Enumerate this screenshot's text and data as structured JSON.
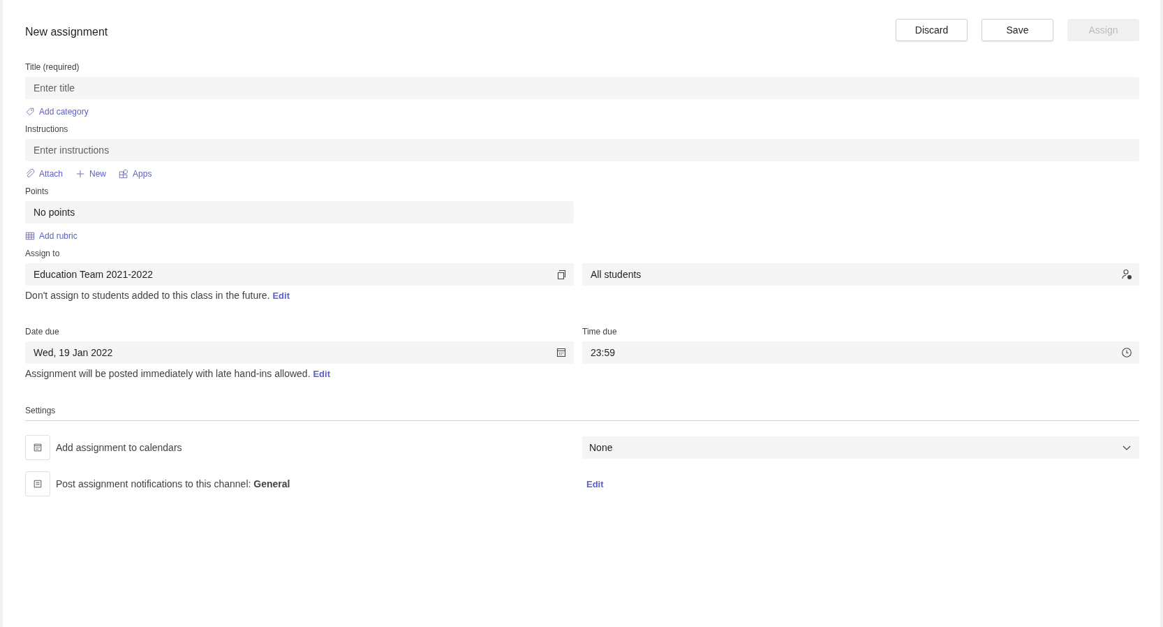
{
  "header": {
    "title": "New assignment"
  },
  "actions": [
    {
      "label": "Discard",
      "disabled": false
    },
    {
      "label": "Save",
      "disabled": false
    },
    {
      "label": "Assign",
      "disabled": true
    }
  ],
  "title_field": {
    "label": "Title (required)",
    "placeholder": "Enter title"
  },
  "add_category": "Add category",
  "instructions_field": {
    "label": "Instructions",
    "placeholder": "Enter instructions"
  },
  "attach_tools": [
    {
      "kind": "attach",
      "label": "Attach"
    },
    {
      "kind": "new",
      "label": "New"
    },
    {
      "kind": "apps",
      "label": "Apps"
    }
  ],
  "points_field": {
    "label": "Points",
    "value": "No points"
  },
  "add_rubric": "Add rubric",
  "assign_to": {
    "label": "Assign to",
    "class_value": "Education Team 2021-2022",
    "students_value": "All students",
    "note": "Don't assign to students added to this class in the future.",
    "note_link": "Edit"
  },
  "date_due": {
    "label": "Date due",
    "value": "Wed, 19 Jan 2022"
  },
  "time_due": {
    "label": "Time due",
    "value": "23:59"
  },
  "schedule_note": {
    "text": "Assignment will be posted immediately with late hand-ins allowed.",
    "link": "Edit"
  },
  "settings": {
    "heading": "Settings",
    "rows": [
      {
        "kind": "calendar",
        "text": "Add assignment to calendars",
        "dropdown": {
          "value": "None"
        }
      },
      {
        "kind": "channel",
        "text": "Post assignment notifications to this channel: **General**",
        "link": "Edit"
      }
    ]
  }
}
